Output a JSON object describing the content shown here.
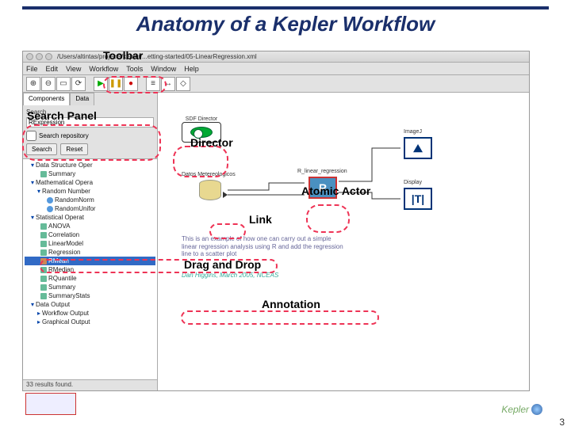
{
  "slide": {
    "title": "Anatomy of a Kepler Workflow",
    "page_number": "3",
    "logo_text": "Kepler"
  },
  "callouts": {
    "toolbar": "Toolbar",
    "search_panel": "Search Panel",
    "director": "Director",
    "atomic_actor": "Atomic Actor",
    "link": "Link",
    "drag_drop": "Drag and Drop",
    "annotation": "Annotation"
  },
  "window": {
    "title": "/Users/altintas/projects/kepler/...etting-started/05-LinearRegression.xml",
    "menus": [
      "File",
      "Edit",
      "View",
      "Workflow",
      "Tools",
      "Window",
      "Help"
    ],
    "tabs": {
      "components": "Components",
      "data": "Data"
    },
    "search": {
      "label": "Search",
      "value": "RExpression",
      "repo_check": "Search repository",
      "search_btn": "Search",
      "reset_btn": "Reset"
    },
    "tree": [
      "Data Structure Oper",
      "Summary",
      "Mathematical Opera",
      "Random Number",
      "RandomNorm",
      "RandomUnifor",
      "Statistical Operat",
      "ANOVA",
      "Correlation",
      "LinearModel",
      "Regression",
      "RMean",
      "RMedian",
      "RQuantile",
      "Summary",
      "SummaryStats",
      "Data Output",
      "Workflow Output",
      "Graphical Output"
    ],
    "status": "33 results found."
  },
  "canvas": {
    "director_label": "SDF Director",
    "source_label": "Datos Metereologicos",
    "workflow_label": "R_linear_regression",
    "actor_r": "R",
    "actor_imagej": "ImageJ",
    "actor_imagej_glyph": "⛰",
    "actor_display": "Display",
    "actor_display_glyph": "|T|",
    "annotation_line1": "This is an example of how one can carry out a simple",
    "annotation_line2": "linear regression analysis using R and add the regression",
    "annotation_line3": "line to a scatter plot",
    "annotation_sig": "Dan Higgins, March 2005, NCEAS"
  }
}
